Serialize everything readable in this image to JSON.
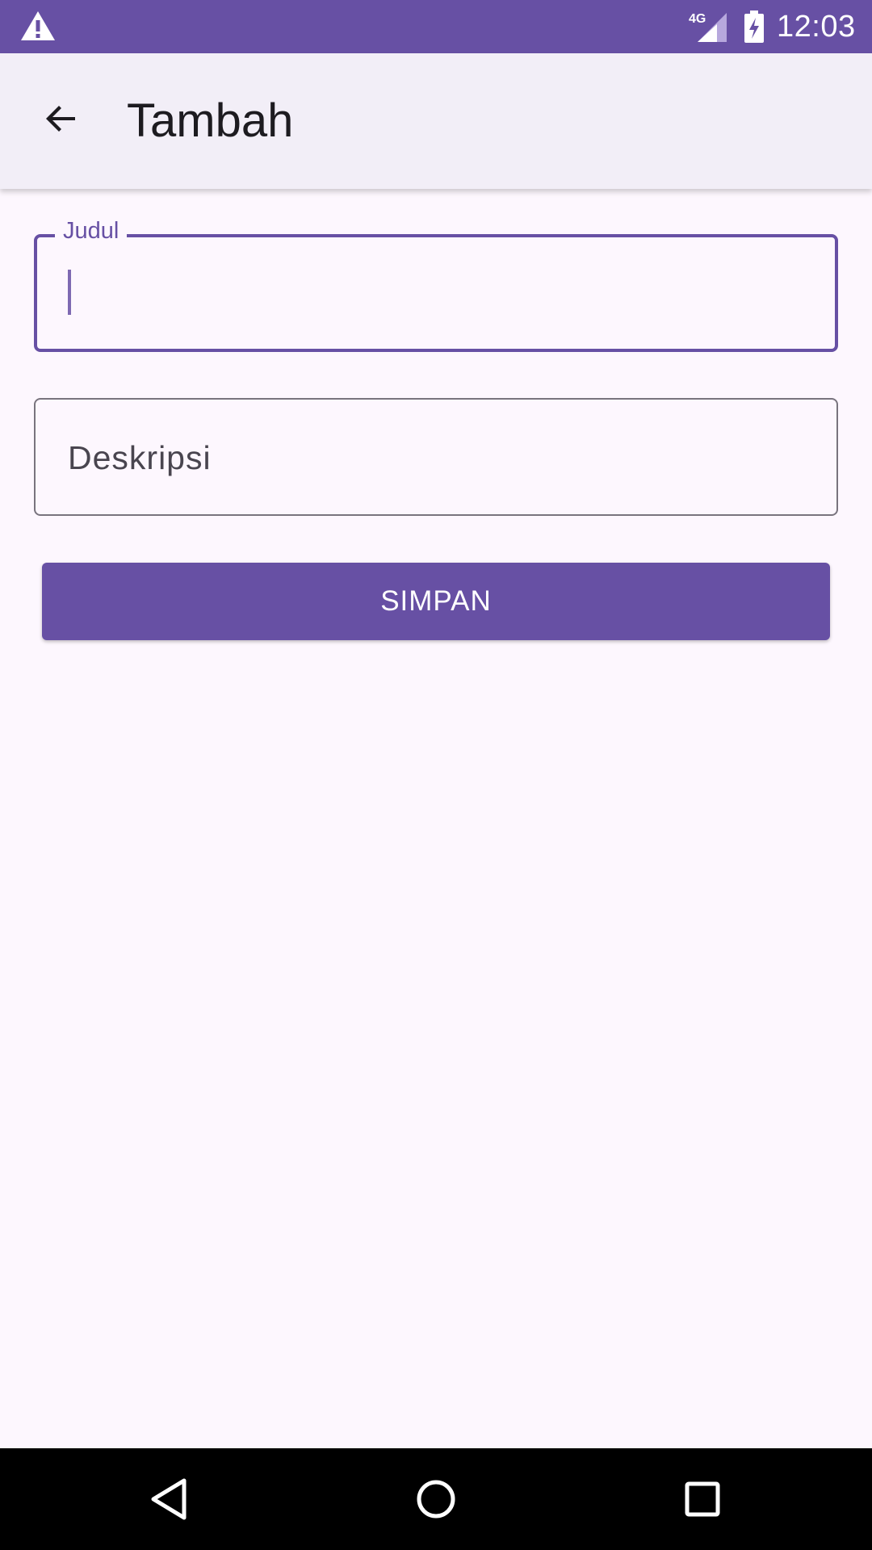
{
  "status_bar": {
    "time": "12:03",
    "network_label": "4G",
    "icons": [
      "warning-icon",
      "signal-4g-icon",
      "battery-charging-icon"
    ],
    "background_color": "#6750a4"
  },
  "app_bar": {
    "title": "Tambah",
    "back_icon": "arrow-back-icon",
    "background_color": "#f2eef7"
  },
  "form": {
    "judul": {
      "label": "Judul",
      "value": "",
      "focused": true
    },
    "deskripsi": {
      "placeholder": "Deskripsi",
      "value": ""
    },
    "save_label": "SIMPAN"
  },
  "nav_bar": {
    "icons": [
      "nav-back-icon",
      "nav-home-icon",
      "nav-recents-icon"
    ]
  },
  "colors": {
    "primary": "#6750a4",
    "background": "#fdf7fe",
    "outline": "#79747e"
  }
}
